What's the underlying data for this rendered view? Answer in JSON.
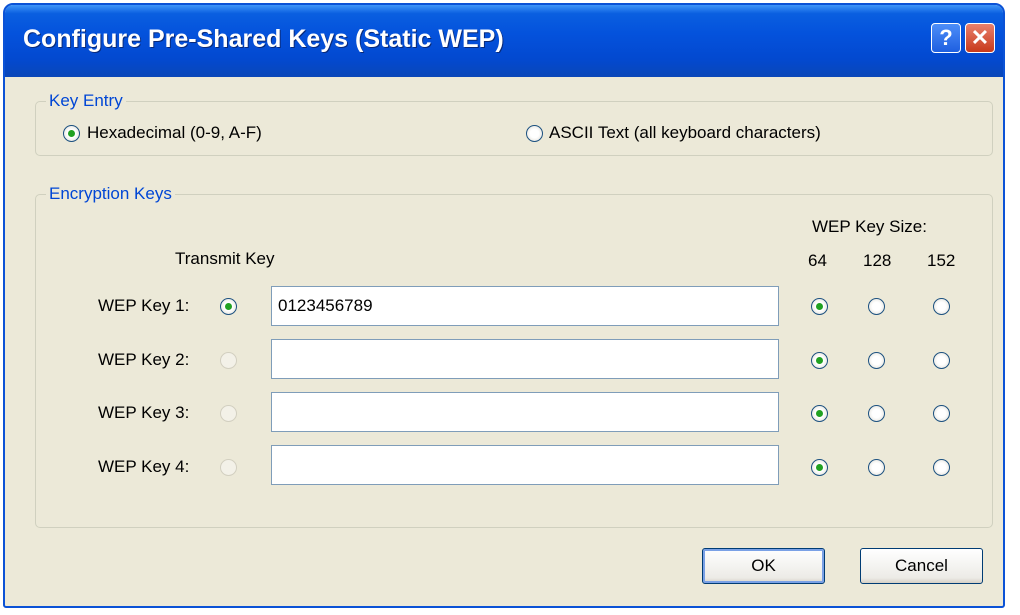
{
  "window": {
    "title": "Configure Pre-Shared Keys (Static WEP)",
    "help_label": "?",
    "close_label": "✕"
  },
  "key_entry": {
    "legend": "Key Entry",
    "hex_label": "Hexadecimal (0-9, A-F)",
    "ascii_label": "ASCII Text (all keyboard characters)",
    "selected": "Hexadecimal (0-9, A-F)"
  },
  "encryption_keys": {
    "legend": "Encryption Keys",
    "transmit_key_header": "Transmit Key",
    "key_size_header": "WEP Key Size:",
    "sizes": [
      "64",
      "128",
      "152"
    ],
    "keys": [
      {
        "label": "WEP Key 1:",
        "value": "0123456789",
        "transmit": true,
        "size": "64"
      },
      {
        "label": "WEP Key 2:",
        "value": "",
        "transmit": false,
        "size": "64"
      },
      {
        "label": "WEP Key 3:",
        "value": "",
        "transmit": false,
        "size": "64"
      },
      {
        "label": "WEP Key 4:",
        "value": "",
        "transmit": false,
        "size": "64"
      }
    ]
  },
  "buttons": {
    "ok_label": "OK",
    "cancel_label": "Cancel"
  },
  "colors": {
    "titlebar": "#0452dc",
    "legend_text": "#0046d5",
    "dialog_bg": "#ece9d8",
    "radio_dot": "#21a121"
  }
}
